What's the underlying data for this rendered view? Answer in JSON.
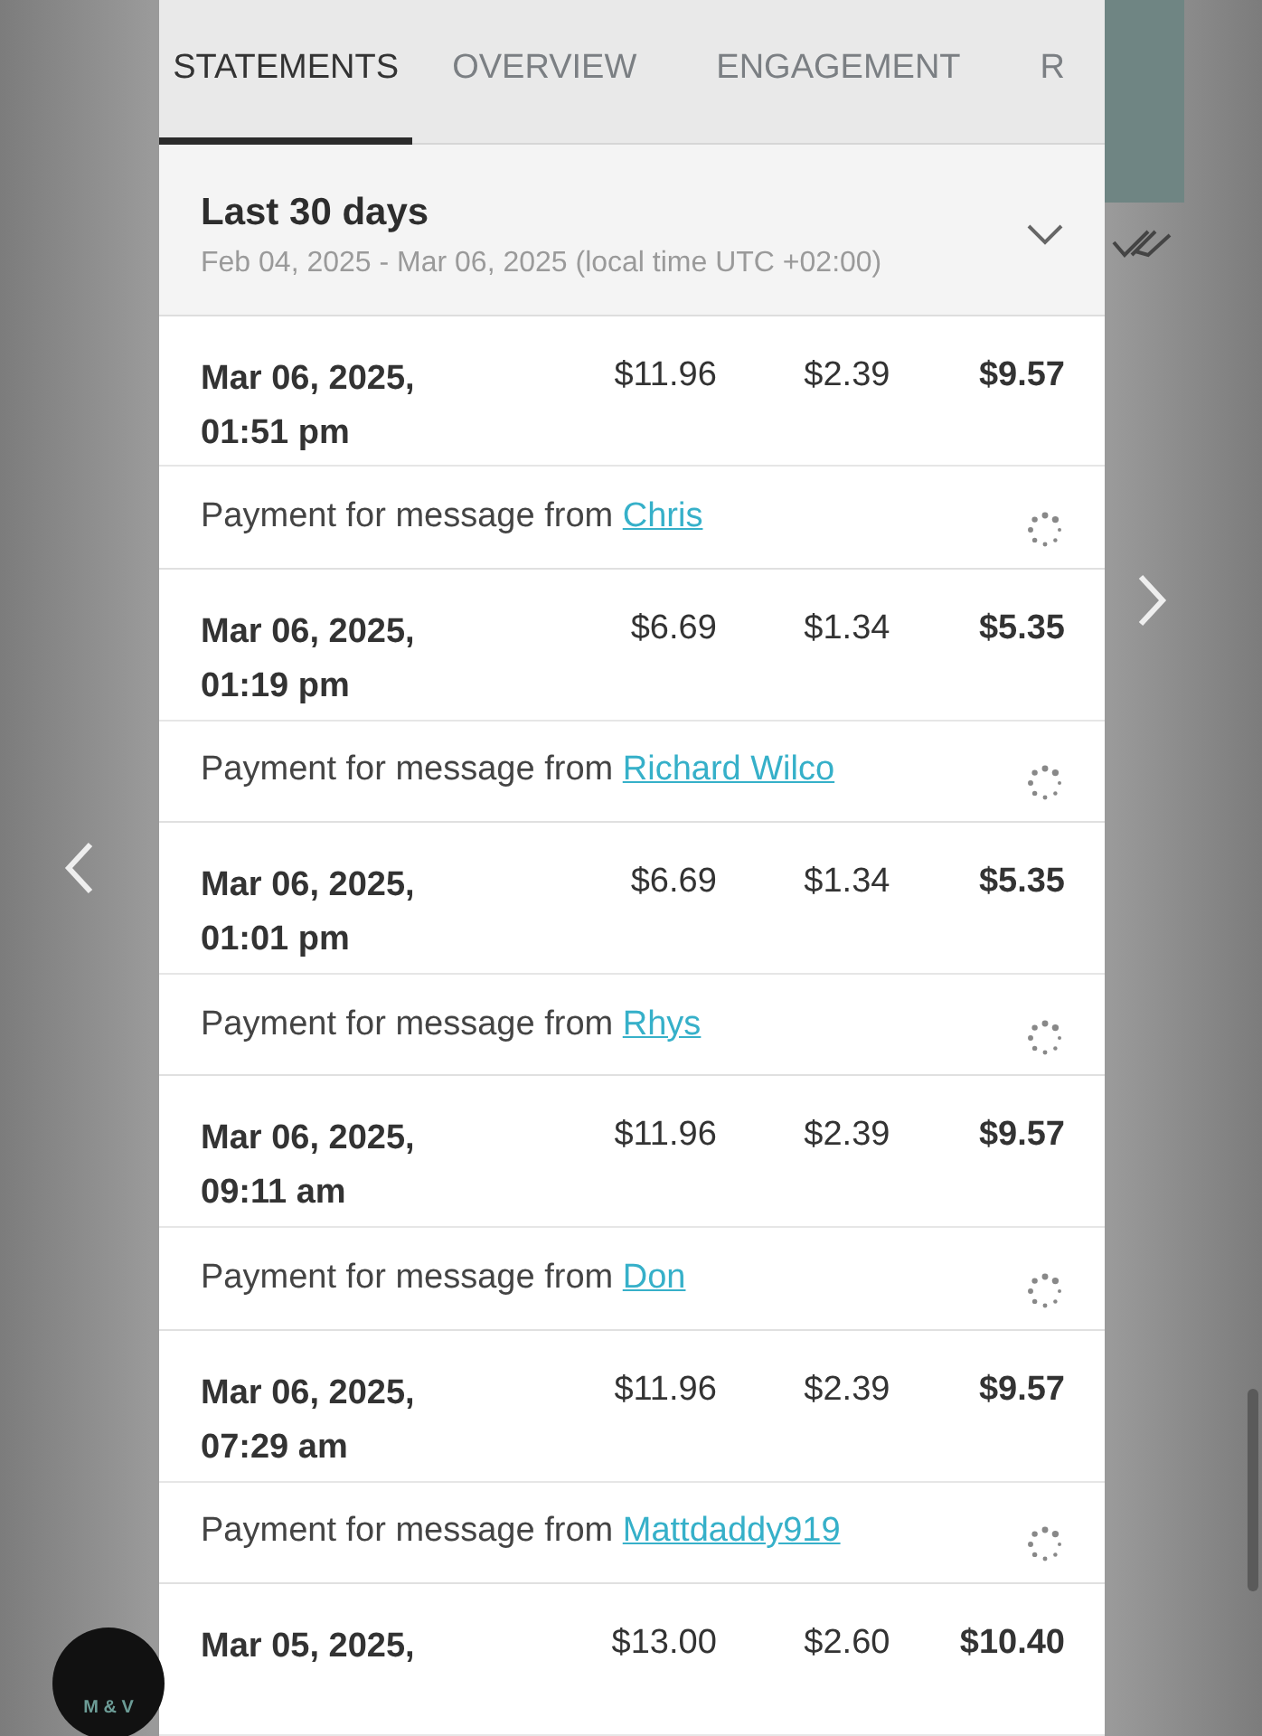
{
  "tabs": [
    {
      "label": "STATEMENTS",
      "selected": true
    },
    {
      "label": "OVERVIEW",
      "selected": false
    },
    {
      "label": "ENGAGEMENT",
      "selected": false
    },
    {
      "label": "R",
      "selected": false
    }
  ],
  "filter": {
    "title": "Last 30 days",
    "range": "Feb 04, 2025 - Mar 06, 2025 (local time UTC +02:00)",
    "expanded": false
  },
  "transactions": [
    {
      "date": "Mar 06, 2025,",
      "time": "01:51 pm",
      "gross": "$11.96",
      "fee": "$2.39",
      "net": "$9.57",
      "description": "Payment for message from",
      "sender": "Chris",
      "pending": true
    },
    {
      "date": "Mar 06, 2025,",
      "time": "01:19 pm",
      "gross": "$6.69",
      "fee": "$1.34",
      "net": "$5.35",
      "description": "Payment for message from",
      "sender": "Richard Wilco",
      "pending": true
    },
    {
      "date": "Mar 06, 2025,",
      "time": "01:01 pm",
      "gross": "$6.69",
      "fee": "$1.34",
      "net": "$5.35",
      "description": "Payment for message from",
      "sender": "Rhys",
      "pending": true
    },
    {
      "date": "Mar 06, 2025,",
      "time": "09:11 am",
      "gross": "$11.96",
      "fee": "$2.39",
      "net": "$9.57",
      "description": "Payment for message from",
      "sender": "Don",
      "pending": true
    },
    {
      "date": "Mar 06, 2025,",
      "time": "07:29 am",
      "gross": "$11.96",
      "fee": "$2.39",
      "net": "$9.57",
      "description": "Payment for message from",
      "sender": "Mattdaddy919",
      "pending": true
    },
    {
      "date": "Mar 05, 2025,",
      "gross": "$13.00",
      "fee": "$2.60",
      "net": "$10.40"
    }
  ],
  "overlay_logo": {
    "text": "M & V"
  }
}
